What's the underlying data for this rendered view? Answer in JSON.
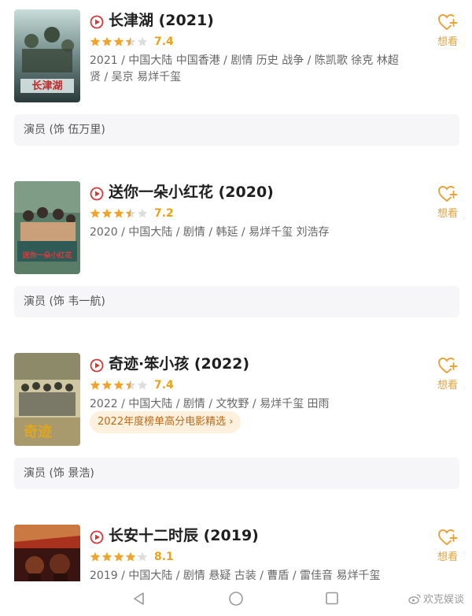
{
  "movies": [
    {
      "title": "长津湖 (2021)",
      "stars": 3.5,
      "score": "7.4",
      "meta": "2021 / 中国大陆 中国香港 / 剧情 历史 战争 / 陈凯歌 徐克 林超贤 / 吴京 易烊千玺",
      "role": "演员 (饰 伍万里)",
      "want_label": "想看",
      "poster_text": "长津湖",
      "poster_colors": [
        "#2a3a3a",
        "#6f8a88",
        "#c8ddd9"
      ]
    },
    {
      "title": "送你一朵小红花 (2020)",
      "stars": 3.5,
      "score": "7.2",
      "meta": "2020 / 中国大陆 / 剧情 / 韩延 / 易烊千玺 刘浩存",
      "role": "演员 (饰 韦一航)",
      "want_label": "想看",
      "poster_text": "送你一朵小红花",
      "poster_colors": [
        "#5a7d68",
        "#c9a07a",
        "#2f5a55"
      ]
    },
    {
      "title": "奇迹·笨小孩 (2022)",
      "stars": 3.5,
      "score": "7.4",
      "meta": "2022 / 中国大陆 / 剧情 / 文牧野 / 易烊千玺 田雨",
      "promo": "2022年度榜单高分电影精选 ›",
      "role": "演员 (饰 景浩)",
      "want_label": "想看",
      "poster_text": "奇迹",
      "poster_colors": [
        "#8d8a6a",
        "#cfc6a2",
        "#d8a020"
      ]
    },
    {
      "title": "长安十二时辰 (2019)",
      "stars": 4,
      "score": "8.1",
      "meta": "2019 / 中国大陆 / 剧情 悬疑 古装 / 曹盾 / 雷佳音 易烊千玺",
      "want_label": "想看",
      "poster_text": "",
      "poster_colors": [
        "#3a1410",
        "#a8321e",
        "#e2a85a"
      ]
    }
  ],
  "nav": {
    "back": "back",
    "home": "home",
    "recent": "recent"
  },
  "watermark": "欢克娱谈",
  "colors": {
    "accent": "#e6a33a",
    "play": "#d33a3a",
    "star": "#f0a52a",
    "star_empty": "#dddddd"
  }
}
